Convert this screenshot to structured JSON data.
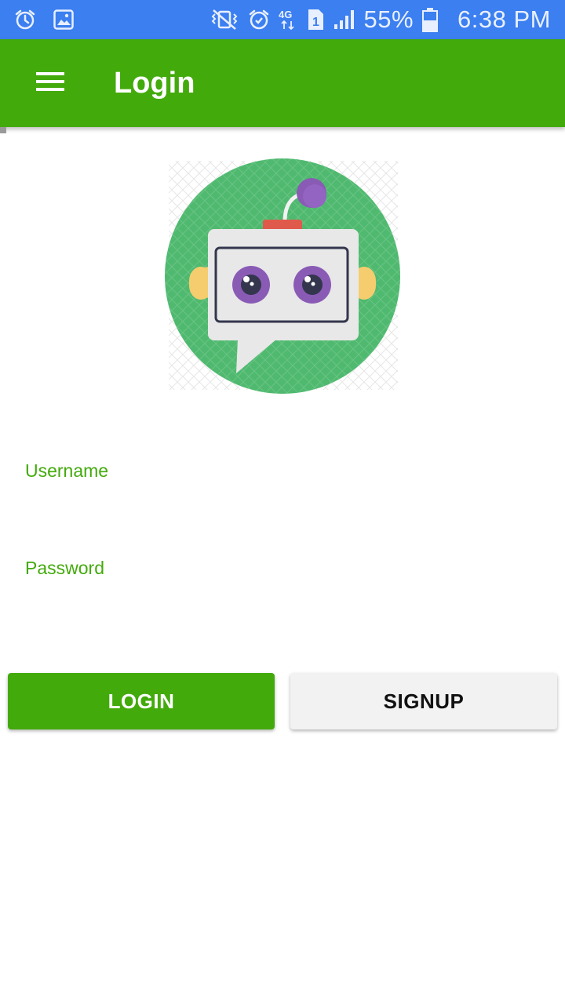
{
  "status_bar": {
    "battery": "55%",
    "time": "6:38 PM",
    "network": "4G",
    "sim_slot": "1",
    "icons_left": [
      "alarm-icon",
      "image-icon"
    ],
    "icons_right": [
      "vibrate-mute-icon",
      "alarm-icon",
      "network-4g-icon",
      "sim-1-icon",
      "signal-icon",
      "battery-icon"
    ]
  },
  "app_bar": {
    "title": "Login",
    "menu_icon": "hamburger-menu-icon"
  },
  "logo": {
    "icon": "robot-chat-logo",
    "colors": {
      "circle": "#4fba6f",
      "eyes": "#8a5bb5",
      "antenna": "#8a5bb5",
      "ears": "#f5cd6e",
      "top_cap": "#e05a4b"
    }
  },
  "form": {
    "username": {
      "label": "Username",
      "value": ""
    },
    "password": {
      "label": "Password",
      "value": ""
    }
  },
  "buttons": {
    "login": "LOGIN",
    "signup": "SIGNUP"
  },
  "colors": {
    "status_bar": "#3b7ff0",
    "accent": "#43aa0c",
    "secondary_button": "#f2f2f2"
  }
}
